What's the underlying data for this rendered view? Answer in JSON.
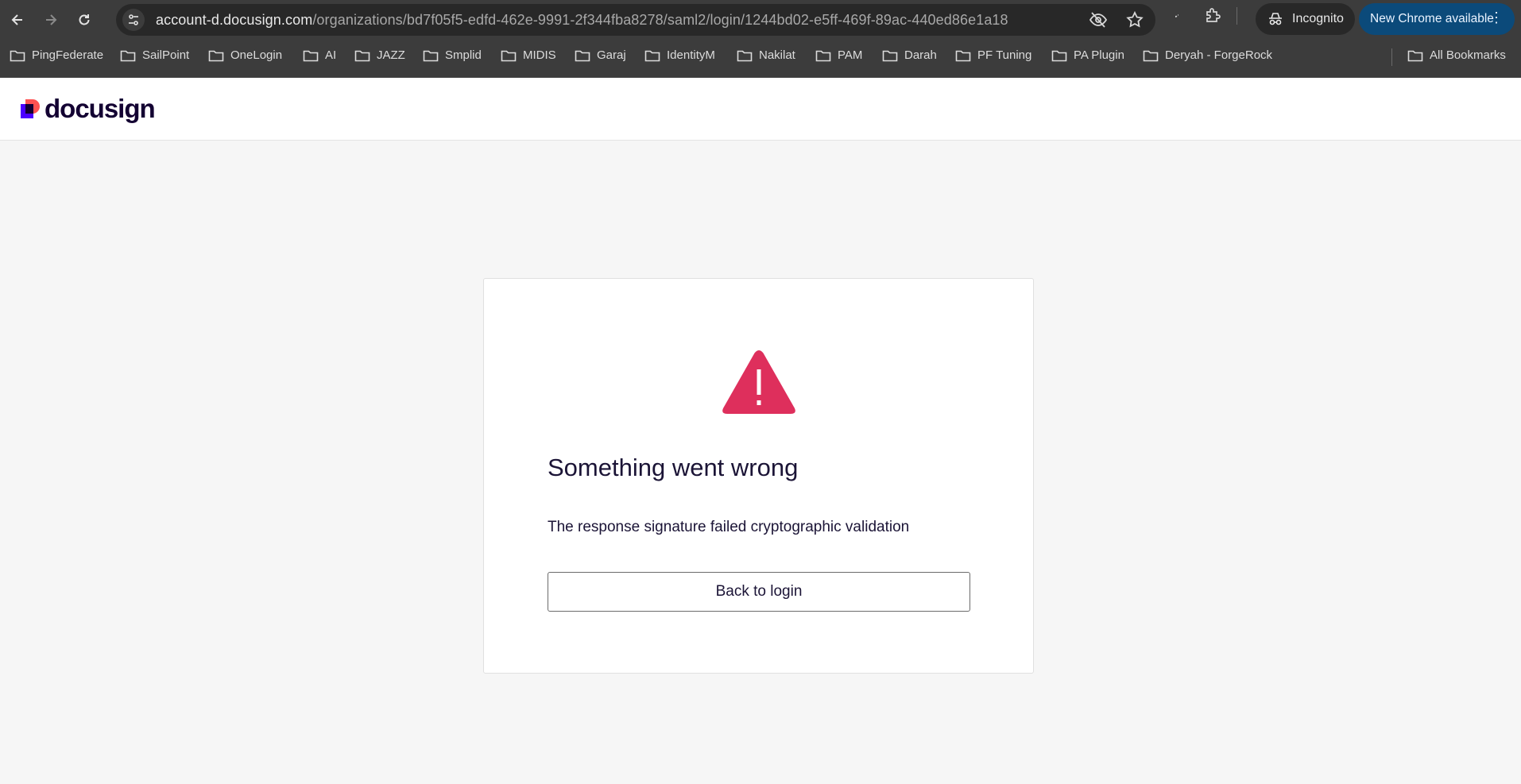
{
  "browser": {
    "url_host": "account-d.docusign.com",
    "url_path": "/organizations/bd7f05f5-edfd-462e-9991-2f344fba8278/saml2/login/1244bd02-e5ff-469f-89ac-440ed86e1a18",
    "incognito_label": "Incognito",
    "update_label": "New Chrome available",
    "all_bookmarks_label": "All Bookmarks",
    "bookmarks": [
      "PingFederate",
      "SailPoint",
      "OneLogin",
      "AI",
      "JAZZ",
      "Smplid",
      "MIDIS",
      "Garaj",
      "IdentityM",
      "Nakilat",
      "PAM",
      "Darah",
      "PF Tuning",
      "PA Plugin",
      "Deryah - ForgeRock"
    ],
    "icons": {
      "back": "arrow-left-icon",
      "forward": "arrow-right-icon",
      "reload": "reload-icon",
      "site_info": "tune-icon",
      "eye_off": "eye-off-icon",
      "star": "star-icon",
      "extensions": "puzzle-icon",
      "incognito": "incognito-icon",
      "folder": "folder-icon"
    }
  },
  "page": {
    "logo_text": "docusign",
    "error_title": "Something went wrong",
    "error_message": "The response signature failed cryptographic validation",
    "back_button_label": "Back to login"
  },
  "colors": {
    "warning": "#de2f5c",
    "brand_text": "#130032",
    "logo_purple": "#4c00ff",
    "logo_red": "#ff5252",
    "update_pill": "#0b4a7a"
  }
}
